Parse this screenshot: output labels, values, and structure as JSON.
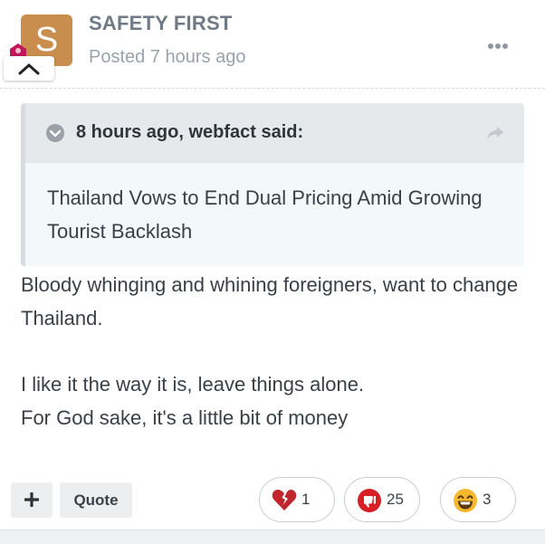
{
  "post": {
    "author": "SAFETY FIRST",
    "avatar_letter": "S",
    "posted": "Posted 7 hours ago",
    "avatar_color": "#c98e4d"
  },
  "quote": {
    "citation": "8 hours ago, webfact said:",
    "text": "Thailand Vows to End Dual Pricing Amid Growing Tourist Backlash"
  },
  "body": {
    "paragraphs": [
      "Bloody whinging and whining foreigners, want to change Thailand.",
      "I like it the way it is, leave things alone.",
      "For God sake, it's a little bit of money"
    ]
  },
  "actions": {
    "quote_label": "Quote"
  },
  "reactions": [
    {
      "icon": "broken-heart-icon",
      "count": "1",
      "color": "#c0262c"
    },
    {
      "icon": "thumbs-down-icon",
      "count": "25",
      "color": "#d81f26"
    },
    {
      "icon": "laughing-face-icon",
      "count": "3",
      "color": "#f5b82e"
    }
  ]
}
